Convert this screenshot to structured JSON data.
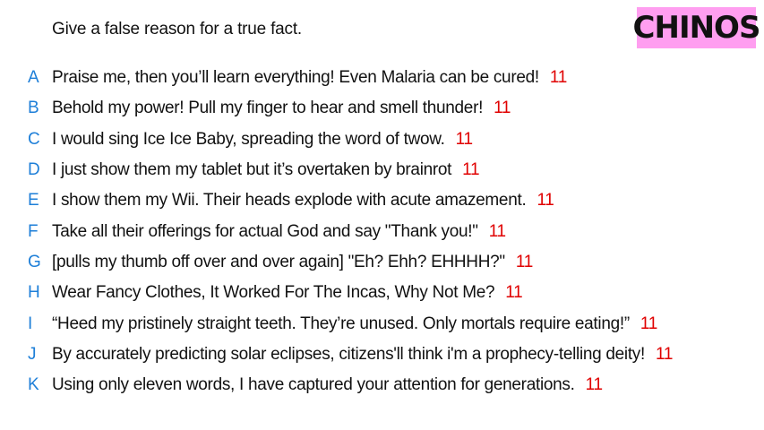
{
  "prompt": "Give a false reason for a true fact.",
  "brand_label": "CHINOS",
  "colors": {
    "letter": "#1e7fd8",
    "score": "#e00000",
    "brand_background": "#ff9ef0",
    "text": "#111111"
  },
  "answers": [
    {
      "letter": "A",
      "text": "Praise me, then you’ll learn everything! Even Malaria can be cured!",
      "score": "11"
    },
    {
      "letter": "B",
      "text": "Behold my power! Pull my finger to hear and smell thunder!",
      "score": "11"
    },
    {
      "letter": "C",
      "text": "I would sing Ice Ice Baby, spreading the word of twow.",
      "score": "11"
    },
    {
      "letter": "D",
      "text": "I just show them my tablet but it’s overtaken by brainrot",
      "score": "11"
    },
    {
      "letter": "E",
      "text": "I show them my Wii. Their heads explode with acute amazement.",
      "score": "11"
    },
    {
      "letter": "F",
      "text": "Take all their offerings for actual God and say \"Thank you!\"",
      "score": "11"
    },
    {
      "letter": "G",
      "text": "[pulls my thumb off over and over again] \"Eh? Ehh? EHHHH?\"",
      "score": "11"
    },
    {
      "letter": "H",
      "text": "Wear Fancy Clothes, It Worked For The Incas, Why Not Me?",
      "score": "11"
    },
    {
      "letter": "I",
      "text": "“Heed my pristinely straight teeth. They’re unused. Only mortals require eating!”",
      "score": "11"
    },
    {
      "letter": "J",
      "text": "By accurately predicting solar eclipses, citizens'll think i'm a prophecy-telling deity!",
      "score": "11"
    },
    {
      "letter": "K",
      "text": "Using only eleven words, I have captured your attention for generations.",
      "score": "11"
    }
  ]
}
